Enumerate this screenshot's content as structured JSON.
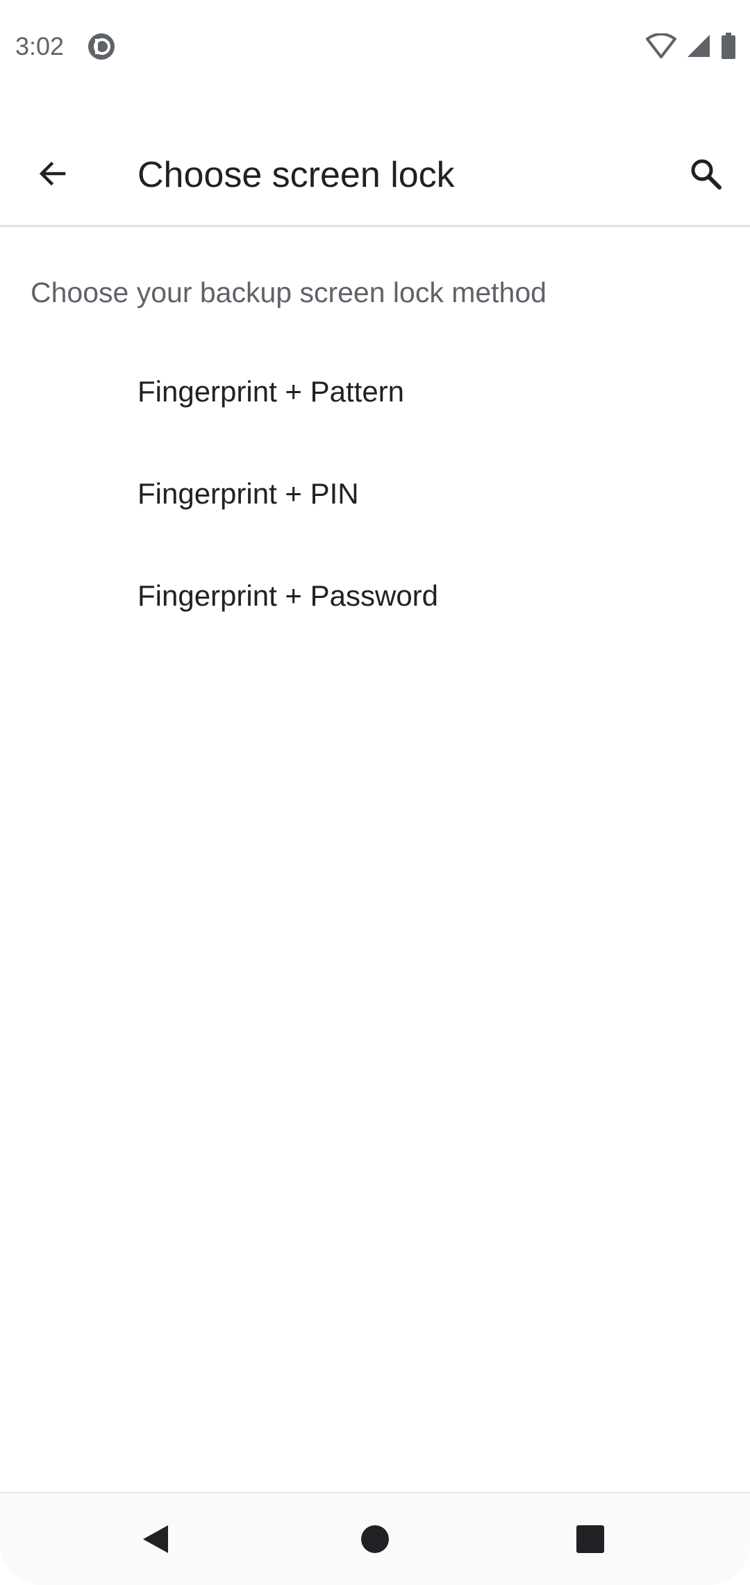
{
  "status_bar": {
    "time": "3:02",
    "app_icon": "pocket-casts-icon",
    "icons": [
      "wifi-icon",
      "cellular-signal-icon",
      "battery-icon"
    ]
  },
  "app_bar": {
    "title": "Choose screen lock",
    "back_icon": "arrow-back-icon",
    "search_icon": "search-icon"
  },
  "content": {
    "subtitle": "Choose your backup screen lock method",
    "options": [
      {
        "label": "Fingerprint + Pattern"
      },
      {
        "label": "Fingerprint + PIN"
      },
      {
        "label": "Fingerprint + Password"
      }
    ]
  },
  "nav_bar": {
    "icons": [
      "nav-back-icon",
      "nav-home-icon",
      "nav-recents-icon"
    ]
  },
  "colors": {
    "primary_text": "#202124",
    "secondary_text": "#5f6368",
    "divider": "#dadce0"
  }
}
